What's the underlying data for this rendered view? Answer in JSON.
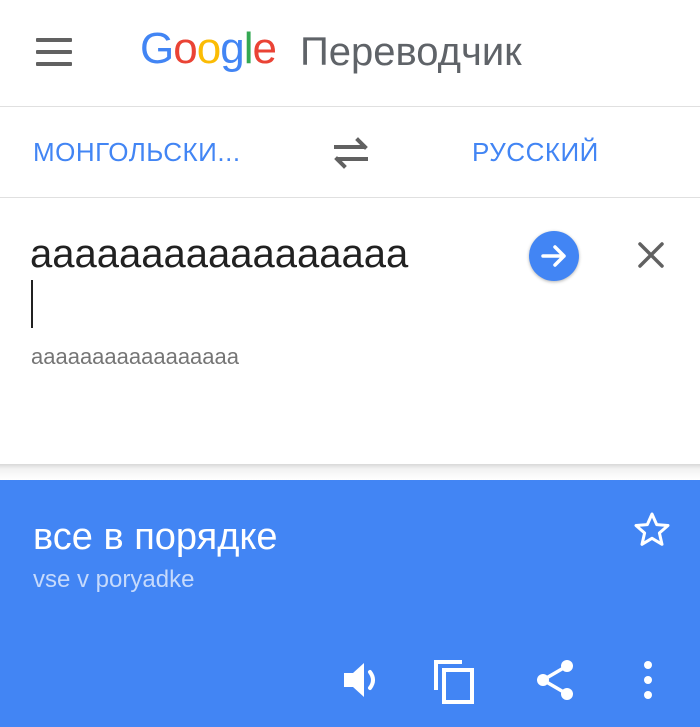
{
  "header": {
    "logo_letters": [
      {
        "char": "G",
        "color": "#4285f4"
      },
      {
        "char": "o",
        "color": "#ea4335"
      },
      {
        "char": "o",
        "color": "#fbbc05"
      },
      {
        "char": "g",
        "color": "#4285f4"
      },
      {
        "char": "l",
        "color": "#34a853"
      },
      {
        "char": "e",
        "color": "#ea4335"
      }
    ],
    "logo_text": "Google",
    "title": "Переводчик",
    "menu_icon": "hamburger-menu-icon"
  },
  "languages": {
    "source": "МОНГОЛЬСКИ...",
    "target": "РУССКИЙ",
    "swap_icon": "swap-arrows-icon"
  },
  "input": {
    "text": "ааааааааааааааааа",
    "romanization": "aaaaaaaaaaaaaaaaa",
    "go_icon": "arrow-right-icon",
    "clear_icon": "close-icon"
  },
  "result": {
    "translation": "все в порядке",
    "transliteration": "vse v poryadke",
    "star_icon": "star-outline-icon",
    "actions": [
      "speaker-icon",
      "copy-icon",
      "share-icon",
      "more-vert-icon"
    ]
  },
  "colors": {
    "accent": "#4285f4",
    "result_bg": "#4285f4",
    "text_dark": "#212121",
    "text_grey": "#757575"
  }
}
